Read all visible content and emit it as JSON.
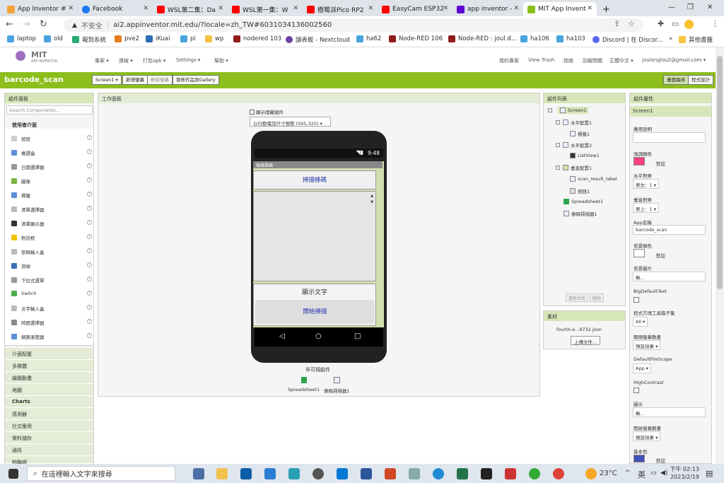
{
  "browser": {
    "tabs": [
      {
        "label": "App Inventor #"
      },
      {
        "label": "Facebook"
      },
      {
        "label": "WSL第二集：Da"
      },
      {
        "label": "WSL第一集：W"
      },
      {
        "label": "樹莓派Pico RP2"
      },
      {
        "label": "EasyCam ESP32"
      },
      {
        "label": "app inventor - "
      },
      {
        "label": "MIT App Invent"
      }
    ],
    "new_tab": "+",
    "insecure_label": "不安全",
    "url": "ai2.appinventor.mit.edu/?locale=zh_TW#6031034136002560",
    "bookmarks": [
      "laptop",
      "old",
      "報到系統",
      "pve2",
      "iKuai",
      "pi",
      "wp",
      "nodered 103",
      "讀表板 - Nextcloud",
      "ha62",
      "Node-RED 106",
      "Node-RED : joul.d...",
      "ha106",
      "ha103",
      "Discord | 在 Discor..."
    ],
    "bookmarks_more": "»",
    "other_bookmarks": "其他書籤"
  },
  "ai_header": {
    "logo_mit": "MIT",
    "logo_sub": "APP INVENTOR",
    "menus": [
      "專案 ▾",
      "連線 ▾",
      "打包apk ▾",
      "Settings ▾",
      "幫助 ▾"
    ],
    "right_links": [
      "我的專案",
      "View Trash",
      "指南",
      "回報問題",
      "正體中文 ▾",
      "joulonglou2@gmail.com ▾"
    ]
  },
  "toolbar": {
    "project_name": "barcode_scan",
    "screen_select": "Screen1 ▾",
    "add_screen": "新增螢幕",
    "remove_screen": "刪除螢幕",
    "publish": "發佈作品到Gallery",
    "designer": "畫面編排",
    "blocks": "程式設計"
  },
  "palette": {
    "title": "組件面板",
    "search_placeholder": "Search Components...",
    "section": "使用者介面",
    "items": [
      "按鈕",
      "複選盒",
      "日期選擇器",
      "圖像",
      "標籤",
      "清單選擇器",
      "清單顯示器",
      "對話框",
      "密碼輸入盒",
      "滑桿",
      "下拉式選單",
      "Switch",
      "文字輸入盒",
      "時間選擇器",
      "網路瀏覽器"
    ],
    "categories": [
      "介面配置",
      "多媒體",
      "繪圖動畫",
      "地圖",
      "Charts",
      "感測器",
      "社交應用",
      "資料儲存",
      "通訊",
      "物聯網"
    ]
  },
  "viewer": {
    "title": "工作面板",
    "hidden_checkbox": "顯示隱藏組件",
    "preview_select": "以行動電話尺寸預覽 (505,320)",
    "status_time": "9:48",
    "app_title": "條碼掃描",
    "scan_button": "掃描條碼",
    "display_label": "顯示文字",
    "start_button": "開始掃描",
    "nonvisible_title": "非可視組件",
    "nonvisible": [
      "Spreadsheet1",
      "條碼掃描器1"
    ]
  },
  "components": {
    "title": "組件列表",
    "tree": [
      "Screen1",
      "水平配置1",
      "標籤1",
      "水平配置2",
      "ListView1",
      "垂直配置1",
      "scan_result_label",
      "按鈕1",
      "Spreadsheet1",
      "條碼掃描器1"
    ],
    "rename": "重新命名",
    "delete": "刪除"
  },
  "media": {
    "title": "素材",
    "file": "fourth-e...9732.json",
    "upload": "上傳文件..."
  },
  "properties": {
    "title": "組件屬性",
    "component": "Screen1",
    "about_label": "應用說明",
    "accent_label": "強調顏色",
    "accent_value": "默認",
    "align_h_label": "水平對齊",
    "align_h_value": "居左：1 ▾",
    "align_v_label": "垂直對齊",
    "align_v_value": "居上：1 ▾",
    "appname_label": "App名稱",
    "appname_value": "barcode_scan",
    "bgcolor_label": "背景顏色",
    "bgcolor_value": "默認",
    "bgimage_label": "背景圖片",
    "bgimage_value": "無...",
    "bigtext_label": "BigDefaultText",
    "blocks_toolkit_label": "程式方塊工具箱子集",
    "blocks_toolkit_value": "All ▾",
    "close_anim_label": "關閉螢幕動畫",
    "close_anim_value": "預設效果 ▾",
    "filescope_label": "DefaultFileScope",
    "filescope_value": "App ▾",
    "contrast_label": "HighContrast",
    "icon_label": "圖示",
    "icon_value": "無...",
    "open_anim_label": "開啟螢幕動畫",
    "open_anim_value": "預設效果 ▾",
    "primary_label": "基本色",
    "primary_value": "默認"
  },
  "taskbar": {
    "search_placeholder": "在這裡輸入文字來搜尋",
    "weather": "23°C",
    "ime": "英",
    "time": "下午 02:13",
    "date": "2023/2/19"
  },
  "colors": {
    "green_bar": "#8cbe1c",
    "accent": "#ff4081",
    "primary": "#3f51b5",
    "phone_bg": "#d4dfb0"
  }
}
